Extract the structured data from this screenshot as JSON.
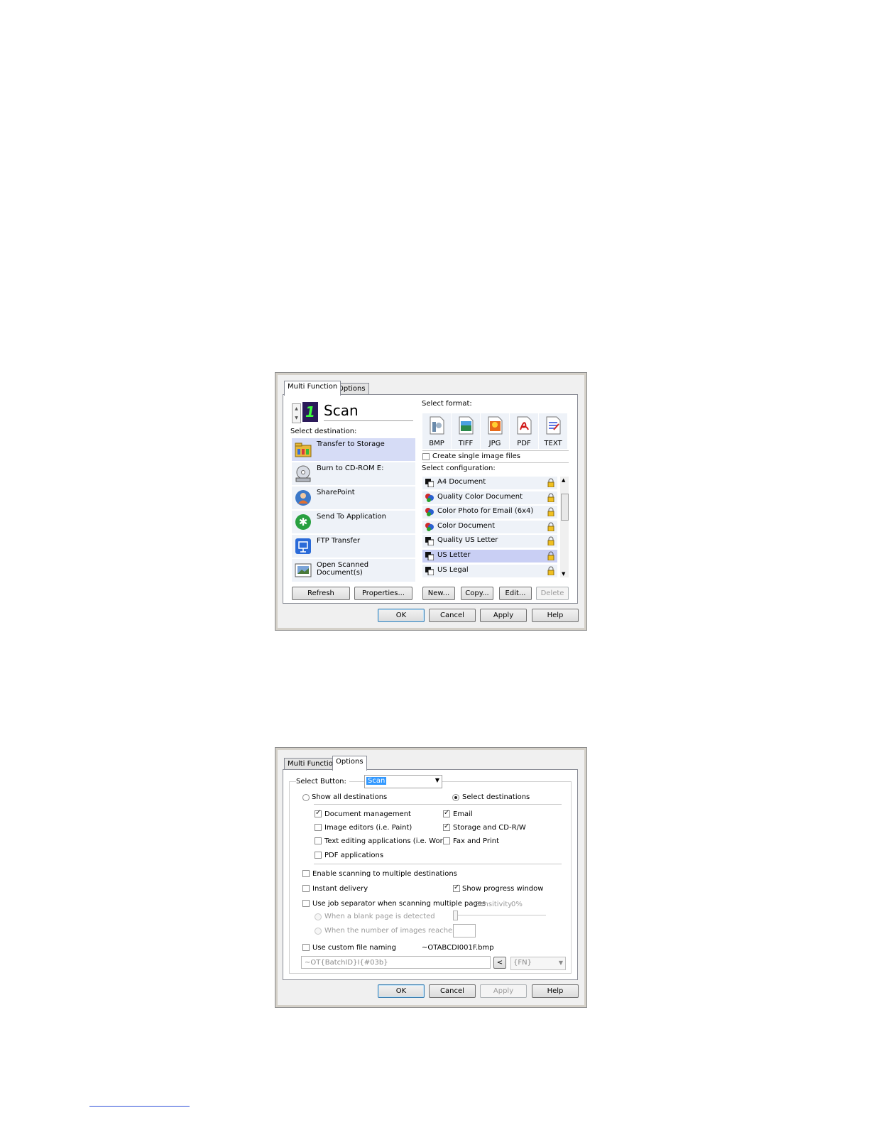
{
  "dialog1": {
    "tabs": [
      "Multi Function",
      "Options"
    ],
    "button_name": "Scan",
    "select_destination_label": "Select destination:",
    "destinations": [
      {
        "label": "Transfer to Storage",
        "icon": "folder-storage-icon",
        "selected": true
      },
      {
        "label": "Burn to CD-ROM  E:",
        "icon": "cd-burn-icon",
        "selected": false
      },
      {
        "label": "SharePoint",
        "icon": "sharepoint-icon",
        "selected": false
      },
      {
        "label": "Send To Application",
        "icon": "send-to-application-icon",
        "selected": false
      },
      {
        "label": "FTP Transfer",
        "icon": "ftp-transfer-icon",
        "selected": false
      },
      {
        "label": "Open Scanned Document(s)",
        "icon": "open-document-icon",
        "selected": false
      }
    ],
    "select_format_label": "Select format:",
    "formats": [
      {
        "label": "BMP",
        "icon": "bmp-format-icon"
      },
      {
        "label": "TIFF",
        "icon": "tiff-format-icon"
      },
      {
        "label": "JPG",
        "icon": "jpg-format-icon"
      },
      {
        "label": "PDF",
        "icon": "pdf-format-icon"
      },
      {
        "label": "TEXT",
        "icon": "text-format-icon"
      }
    ],
    "create_single_label": "Create single image files",
    "select_configuration_label": "Select configuration:",
    "configurations": [
      {
        "label": "A4 Document",
        "color": false,
        "selected": false
      },
      {
        "label": "Quality Color Document",
        "color": true,
        "selected": false
      },
      {
        "label": "Color Photo for Email (6x4)",
        "color": true,
        "selected": false
      },
      {
        "label": "Color Document",
        "color": true,
        "selected": false
      },
      {
        "label": "Quality US Letter",
        "color": false,
        "selected": false
      },
      {
        "label": "US Letter",
        "color": false,
        "selected": true
      },
      {
        "label": "US Legal",
        "color": false,
        "selected": false
      }
    ],
    "buttons": {
      "refresh": "Refresh",
      "properties": "Properties...",
      "new": "New...",
      "copy": "Copy...",
      "edit": "Edit...",
      "delete": "Delete",
      "ok": "OK",
      "cancel": "Cancel",
      "apply": "Apply",
      "help": "Help"
    }
  },
  "dialog2": {
    "tabs": [
      "Multi Function",
      "Options"
    ],
    "select_button_label": "Select Button:",
    "select_button_value": "Scan",
    "show_all_label": "Show all destinations",
    "select_dest_label": "Select destinations",
    "categories_left": [
      {
        "label": "Document management",
        "checked": true
      },
      {
        "label": "Image editors (i.e. Paint)",
        "checked": false
      },
      {
        "label": "Text editing applications (i.e. Word)",
        "checked": false
      },
      {
        "label": "PDF applications",
        "checked": false
      }
    ],
    "categories_right": [
      {
        "label": "Email",
        "checked": true
      },
      {
        "label": "Storage and CD-R/W",
        "checked": true
      },
      {
        "label": "Fax and Print",
        "checked": false
      }
    ],
    "enable_multi": "Enable scanning to multiple destinations",
    "instant_delivery": "Instant delivery",
    "show_progress": "Show progress window",
    "job_separator": "Use job separator when scanning multiple pages",
    "sensitivity_label": "Sensitivity",
    "sensitivity_value": "0%",
    "blank_page": "When a blank page is detected",
    "num_images": "When the number of images reaches",
    "custom_naming": "Use custom file naming",
    "example_filename": "~OTABCDI001F.bmp",
    "naming_pattern": "~OT{BatchID}I{#03b}",
    "insert_button": "<",
    "token_value": "{FN}",
    "buttons": {
      "ok": "OK",
      "cancel": "Cancel",
      "apply": "Apply",
      "help": "Help"
    }
  }
}
